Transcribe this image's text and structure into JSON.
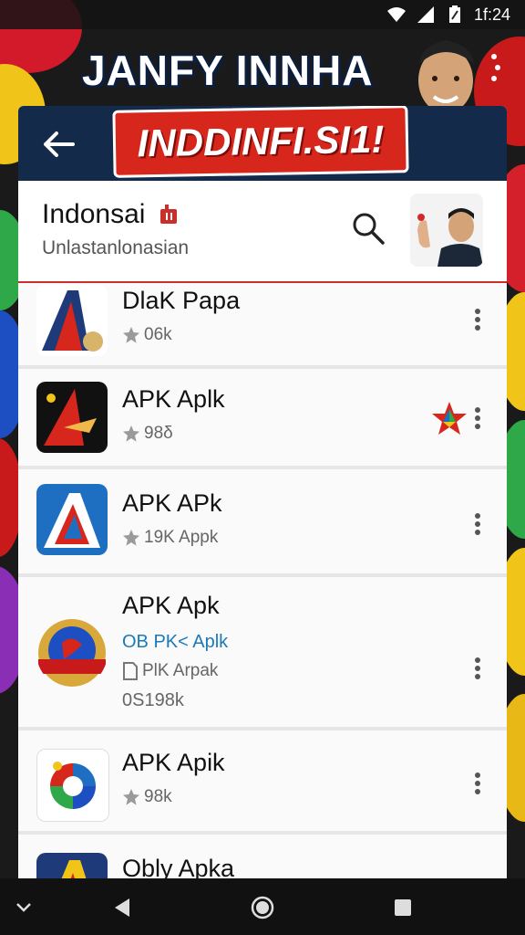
{
  "status_bar": {
    "time": "1f:24",
    "icons": [
      "wifi-icon",
      "signal-icon",
      "battery-icon"
    ]
  },
  "banner": {
    "title": "JANFY INNHA",
    "red_label": "INDDINFI.SI1!"
  },
  "header": {
    "title": "Indonsai",
    "subtitle": "Unlastanlonasian"
  },
  "apps": [
    {
      "name": "DlaK Papa",
      "meta": "06k"
    },
    {
      "name": "APK Aplk",
      "meta": "98δ"
    },
    {
      "name": "APK APk",
      "meta": "19K  Apрk"
    },
    {
      "name": "APK Apk",
      "line1": "OB PK< Aplk",
      "line2": "PlK  Arpak",
      "line3": "0S198k"
    },
    {
      "name": "APK Apik",
      "meta": "98k"
    },
    {
      "name": "Obly Apka"
    }
  ],
  "colors": {
    "accent_red": "#d7261c",
    "navy": "#142a4a",
    "link_blue": "#1a7ab8"
  }
}
